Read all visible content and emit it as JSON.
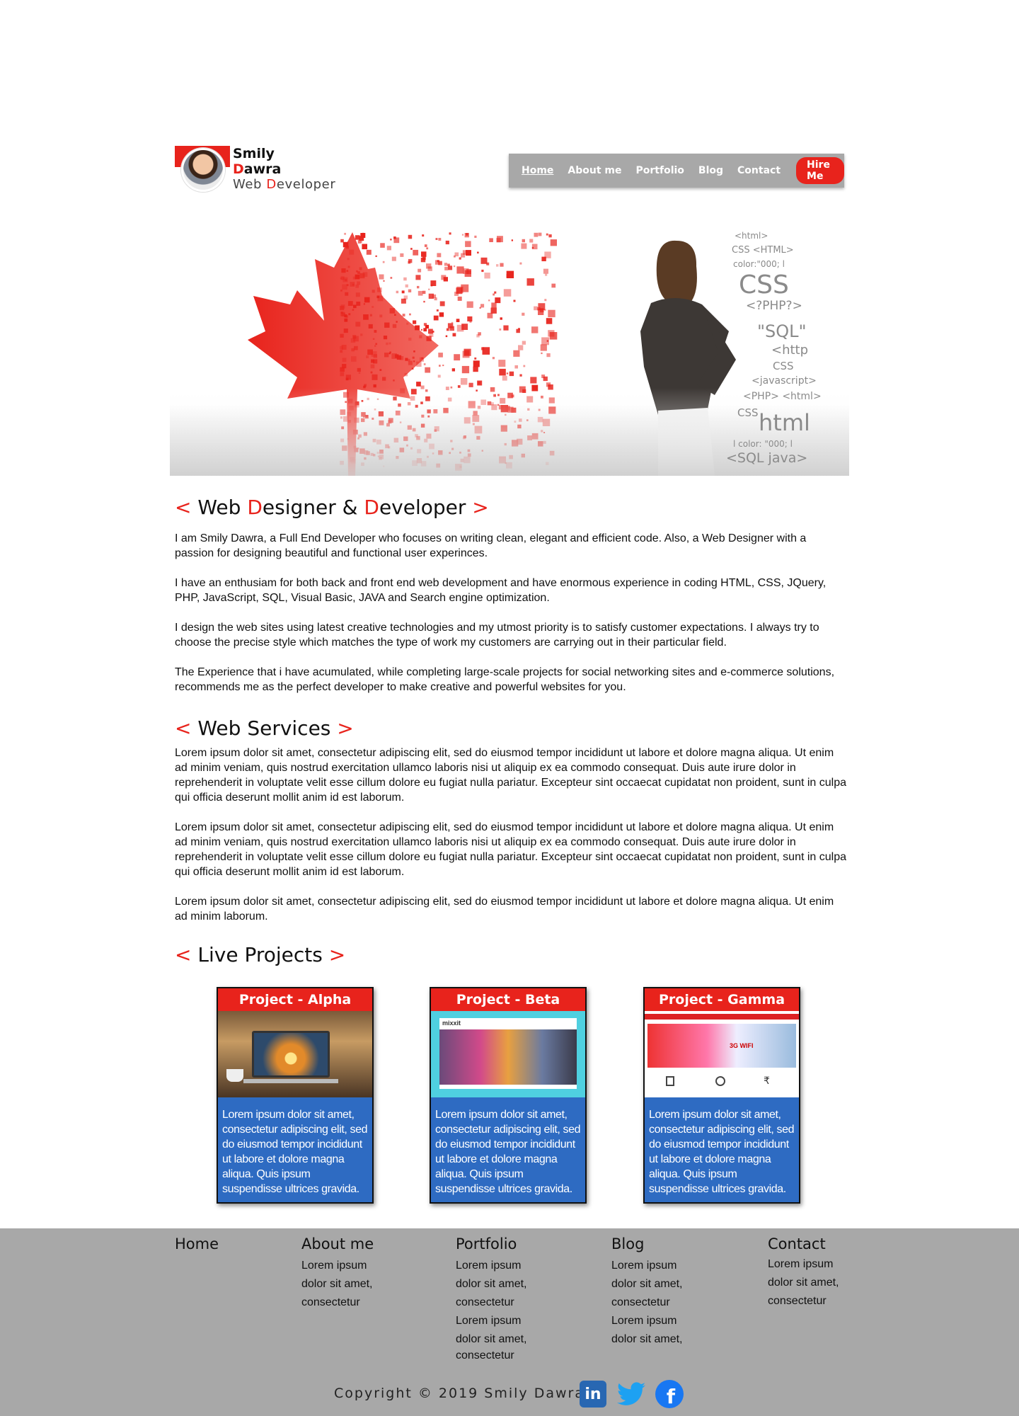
{
  "brand": {
    "name_line1": "Smily",
    "name_line2": "Dawra",
    "title_first": "Web ",
    "title_d": "D",
    "title_rest": "eveloper"
  },
  "nav": {
    "items": [
      "Home",
      "About me",
      "Portfolio",
      "Blog",
      "Contact"
    ],
    "active": "Home",
    "cta": "Hire Me"
  },
  "hero": {
    "code_words": [
      "<html>",
      "CSS <HTML>",
      "color:\"000; l",
      "CSS",
      "<?PHP?>",
      "\"SQL\"",
      "<http",
      "CSS",
      "<javascript>",
      "<PHP> <html>",
      "CSS",
      "html",
      "l color: \"000; l",
      "<SQL java>"
    ]
  },
  "intro": {
    "heading": {
      "open": "< ",
      "w1": "Web ",
      "d1": "D",
      "w2": "esigner & ",
      "d2": "D",
      "w3": "eveloper",
      "close": " >"
    },
    "paragraphs": [
      "I am Smily Dawra, a Full End Developer who focuses on writing clean, elegant and efficient code. Also, a Web Designer with a passion for designing beautiful and functional user experinces.",
      "I have an enthusiam for both back and front end web development and have enormous experience in coding HTML, CSS, JQuery, PHP, JavaScript, SQL, Visual Basic, JAVA and Search engine optimization.",
      "I design the web sites using latest creative technologies and my utmost priority is to satisfy customer expectations. I always try to choose the precise style which matches the type of work my customers are carrying out in their particular field.",
      "The Experience that i have acumulated, while completing large-scale projects for social networking sites and e-commerce solutions, recommends me  as the perfect developer to make creative  and powerful websites  for you."
    ]
  },
  "services": {
    "heading": "Web Services",
    "open": "< ",
    "close": " >",
    "paragraphs": [
      "Lorem ipsum dolor sit amet, consectetur adipiscing elit, sed do eiusmod tempor incididunt ut labore et dolore magna aliqua. Ut enim ad minim veniam, quis nostrud exercitation ullamco laboris nisi ut aliquip ex ea commodo consequat. Duis aute irure dolor in reprehenderit in voluptate velit esse cillum dolore eu fugiat nulla pariatur. Excepteur sint occaecat cupidatat non proident, sunt in culpa qui officia deserunt mollit anim id est laborum.",
      "Lorem ipsum dolor sit amet, consectetur adipiscing elit, sed do eiusmod tempor incididunt ut labore et dolore magna aliqua. Ut enim ad minim veniam, quis nostrud exercitation ullamco laboris nisi ut aliquip ex ea commodo consequat. Duis aute irure dolor in reprehenderit in voluptate velit esse cillum dolore eu fugiat nulla pariatur. Excepteur sint occaecat cupidatat non proident, sunt in culpa qui officia deserunt mollit anim id est laborum.",
      "Lorem ipsum dolor sit amet, consectetur adipiscing elit, sed do eiusmod tempor incididunt ut labore et dolore magna aliqua. Ut enim ad minim  laborum."
    ]
  },
  "projects": {
    "heading": "Live Projects",
    "open": "< ",
    "close": " >",
    "cards": [
      {
        "title": "Project - Alpha",
        "body": "Lorem ipsum dolor sit amet, consectetur adipiscing elit, sed do eiusmod tempor incididunt ut labore et dolore magna aliqua. Quis ipsum suspendisse ultrices gravida."
      },
      {
        "title": "Project - Beta",
        "body": "Lorem ipsum dolor sit amet, consectetur adipiscing elit, sed do eiusmod tempor incididunt ut labore et dolore magna aliqua. Quis ipsum suspendisse ultrices gravida.",
        "thumb_brand": "mixxit"
      },
      {
        "title": "Project - Gamma",
        "body": "Lorem ipsum dolor sit amet, consectetur adipiscing elit, sed do eiusmod tempor incididunt ut labore et dolore magna aliqua. Quis ipsum suspendisse ultrices gravida.",
        "thumb_text": "3G WIFI"
      }
    ]
  },
  "footer": {
    "columns": [
      {
        "title": "Home",
        "items": []
      },
      {
        "title": "About me",
        "items": [
          "Lorem ipsum",
          "dolor sit amet,",
          "consectetur"
        ]
      },
      {
        "title": "Portfolio",
        "items": [
          "Lorem ipsum",
          "dolor sit amet,",
          "consectetur",
          "Lorem ipsum",
          "dolor sit amet,",
          "consectetur"
        ]
      },
      {
        "title": "Blog",
        "items": [
          "Lorem ipsum",
          "dolor sit amet,",
          "consectetur",
          "Lorem ipsum",
          "dolor sit amet,"
        ]
      },
      {
        "title": "Contact",
        "items": [
          "Lorem ipsum",
          "dolor sit amet,",
          "consectetur"
        ]
      }
    ],
    "copyright": "Copyright © 2019 Smily Dawra",
    "social": [
      {
        "icon": "linkedin-icon",
        "glyph": "in",
        "color": "#2867b2"
      },
      {
        "icon": "twitter-icon",
        "color": "#1da1f2"
      },
      {
        "icon": "facebook-icon",
        "glyph": "f",
        "color": "#1877f2"
      }
    ]
  },
  "colors": {
    "accent": "#e8231c",
    "nav_bg": "#a8a8a8",
    "card_body": "#2e6bc2",
    "footer_bg": "#a8a8a8"
  }
}
